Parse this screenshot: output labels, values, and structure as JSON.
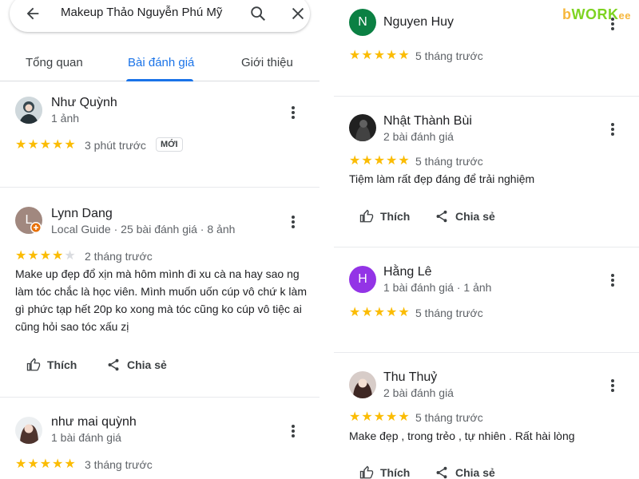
{
  "search": {
    "query": "Makeup Thảo Nguyễn Phú Mỹ"
  },
  "tabs": [
    "Tổng quan",
    "Bài đánh giá",
    "Giới thiệu"
  ],
  "actions": {
    "like": "Thích",
    "share": "Chia sẻ"
  },
  "left_reviews": [
    {
      "name": "Như Quỳnh",
      "meta": "1 ảnh",
      "rating": 5,
      "when": "3 phút trước",
      "badge": "MỚI",
      "text": ""
    },
    {
      "name": "Lynn Dang",
      "meta": "Local Guide · 25 bài đánh giá · 8 ảnh",
      "rating": 4,
      "when": "2 tháng trước",
      "text": "Make up đẹp đổ xịn mà hôm mình đi xu cà na hay sao ng làm tóc chắc là học viên. Mình muốn uốn cúp vô chứ k làm gì phức tạp hết 20p ko xong mà tóc cũng ko cúp vô tiệc ai cũng hỏi sao tóc xấu zị",
      "avatar_letter": "L",
      "avatar_color": "#a1887f"
    },
    {
      "name": "như mai quỳnh",
      "meta": "1 bài đánh giá",
      "rating": 5,
      "when": "3 tháng trước",
      "text": ""
    }
  ],
  "right_reviews": [
    {
      "name": "Nguyen Huy",
      "meta": "",
      "rating": 5,
      "when": "5 tháng trước",
      "text": "",
      "avatar_letter": "N",
      "avatar_color": "#0b8043"
    },
    {
      "name": "Nhật Thành Bùi",
      "meta": "2 bài đánh giá",
      "rating": 5,
      "when": "5 tháng trước",
      "text": "Tiệm làm rất đẹp đáng để trải nghiệm"
    },
    {
      "name": "Hằng Lê",
      "meta": "1 bài đánh giá · 1 ảnh",
      "rating": 5,
      "when": "5 tháng trước",
      "text": "",
      "avatar_letter": "H",
      "avatar_color": "#9334e6"
    },
    {
      "name": "Thu Thuỷ",
      "meta": "2 bài đánh giá",
      "rating": 5,
      "when": "5 tháng trước",
      "text": "Make đẹp , trong trẻo , tự nhiên . Rất hài lòng"
    }
  ],
  "logo": {
    "part1": "b",
    "part2": "WORK",
    "part3": "ee"
  },
  "colors": {
    "star": "#fbbc04",
    "accent": "#1a73e8"
  }
}
